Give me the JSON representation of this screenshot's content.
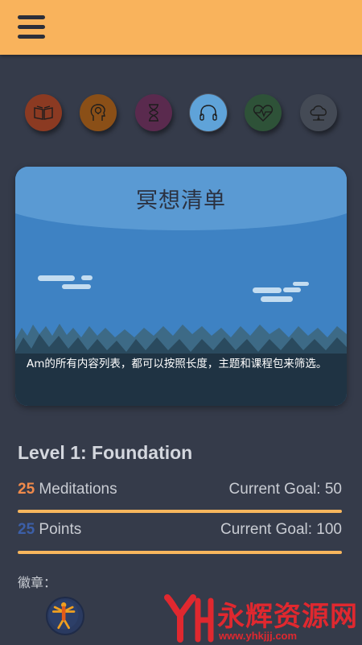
{
  "header": {
    "menu_icon": "hamburger-menu-icon",
    "background_color": "#f9b35c"
  },
  "categories": [
    {
      "icon": "open-book-icon",
      "color": "#8b3a22",
      "selected": false
    },
    {
      "icon": "head-bulb-icon",
      "color": "#8a4f17",
      "selected": false
    },
    {
      "icon": "hourglass-icon",
      "color": "#5a2a4e",
      "selected": false
    },
    {
      "icon": "headphones-icon",
      "color": "#5fa3d9",
      "selected": true
    },
    {
      "icon": "heartbeat-icon",
      "color": "#2e5238",
      "selected": false
    },
    {
      "icon": "cloud-network-icon",
      "color": "#444a55",
      "selected": false
    }
  ],
  "feature_card": {
    "title": "冥想清单",
    "description": "Am的所有内容列表，都可以按照长度，主题和课程包来筛选。"
  },
  "level": {
    "title": "Level 1: Foundation",
    "meditations": {
      "count": "25",
      "label": " Meditations",
      "goal": "Current Goal: 50",
      "progress": 1.0,
      "count_color": "#f08a4b"
    },
    "points": {
      "count": "25",
      "label": " Points",
      "goal": "Current Goal: 100",
      "progress": 1.0,
      "count_color": "#3c5fa8"
    }
  },
  "badges": {
    "label": "徽章：",
    "items": [
      {
        "icon": "vitruvian-man-icon"
      }
    ]
  },
  "watermark": {
    "text": "永辉资源网",
    "url": "www.yhkjjj.com",
    "color": "#e0282f"
  }
}
